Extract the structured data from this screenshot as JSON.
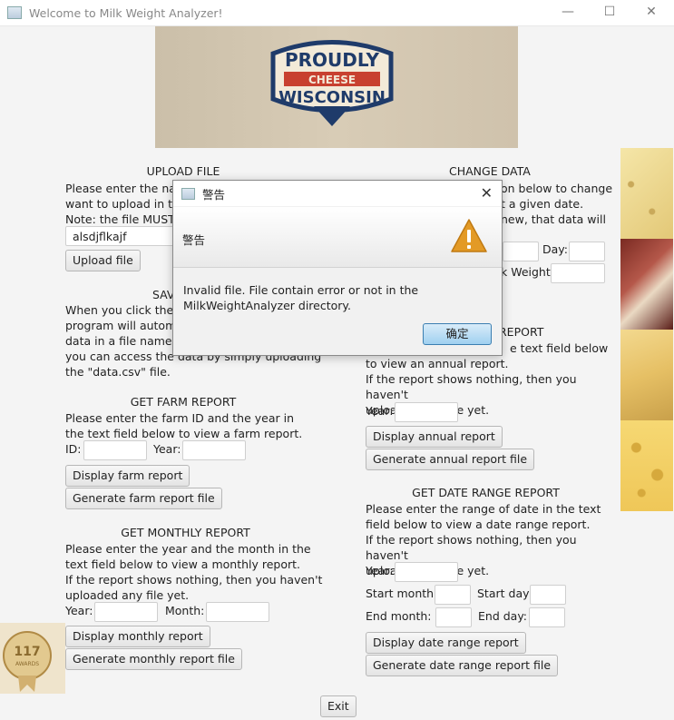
{
  "window": {
    "title": "Welcome to Milk Weight Analyzer!"
  },
  "banner": {
    "line1": "PROUDLY",
    "line2": "CHEESE",
    "line3": "WISCONSIN"
  },
  "award": {
    "number": "117",
    "word": "AWARDS"
  },
  "upload": {
    "heading": "UPLOAD FILE",
    "desc_lines": [
      "Please enter the nam",
      "want to upload in th",
      "Note: the file MUST b"
    ],
    "input_value": "alsdjflkajf",
    "button": "Upload file"
  },
  "save": {
    "heading": "SAV",
    "desc_lines": [
      "When you click the e",
      "program will automa",
      "data in a file named",
      "you can access the data by simply uploading",
      "the \"data.csv\" file."
    ]
  },
  "farm": {
    "heading": "GET FARM REPORT",
    "desc_lines": [
      "Please enter the farm ID and the year in",
      "the text field below to view a farm report."
    ],
    "id_label": "ID:",
    "year_label": "Year:",
    "display_button": "Display farm report",
    "generate_button": "Generate farm report file"
  },
  "monthly": {
    "heading": "GET MONTHLY REPORT",
    "desc_lines": [
      "Please enter the year and the month in the",
      "text field below to view a monthly report.",
      "If the report shows nothing, then you haven't",
      "uploaded any file yet."
    ],
    "year_label": "Year:",
    "month_label": "Month:",
    "display_button": "Display monthly report",
    "generate_button": "Generate monthly report file"
  },
  "change": {
    "heading": "CHANGE DATA",
    "desc_lines": [
      "on below to change",
      "t a given date.",
      "new, that data will"
    ],
    "day_label": "Day:",
    "weight_label": "k Weight:"
  },
  "annual": {
    "heading_partial": "REPORT",
    "desc_lines": [
      "e text field below",
      "to view an annual report.",
      "If the report shows nothing, then you haven't",
      "uploaded any file yet."
    ],
    "year_label": "Year:",
    "display_button": "Display annual report",
    "generate_button": "Generate annual report file"
  },
  "daterange": {
    "heading": "GET DATE RANGE REPORT",
    "desc_lines": [
      "Please enter the range of date in the text",
      "field below to view a date range report.",
      "If the report shows nothing, then you haven't",
      "uploaded any file yet."
    ],
    "year_label": "Year:",
    "start_month_label": "Start month:",
    "start_day_label": "Start day:",
    "end_month_label": "End month:",
    "end_day_label": "End day:",
    "display_button": "Display date range report",
    "generate_button": "Generate date range report file"
  },
  "exit_button": "Exit",
  "dialog": {
    "title": "警告",
    "header_text": "警告",
    "message_lines": [
      "Invalid file. File contain error or not in the",
      "MilkWeightAnalyzer directory."
    ],
    "ok_button": "确定"
  }
}
